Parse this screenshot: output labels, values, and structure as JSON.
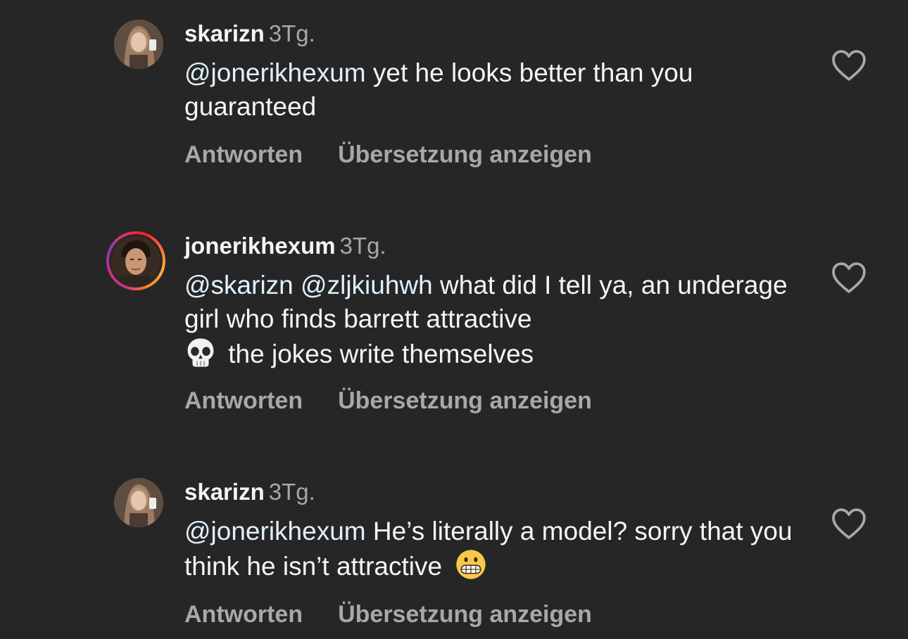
{
  "comments": [
    {
      "username": "skarizn",
      "time": "3Tg.",
      "mention": "@jonerikhexum",
      "text": " yet he looks better than you guaranteed",
      "reply_label": "Antworten",
      "translate_label": "Übersetzung anzeigen",
      "avatar_icon": "avatar-photo",
      "has_story_ring": false
    },
    {
      "username": "jonerikhexum",
      "time": "3Tg.",
      "mention": "@skarizn @zljkiuhwh",
      "text": " what did I tell ya, an underage girl who finds barrett attractive",
      "text_after_emoji": "the jokes write themselves",
      "emoji_icon": "skull-emoji",
      "reply_label": "Antworten",
      "translate_label": "Übersetzung anzeigen",
      "avatar_icon": "avatar-photo",
      "has_story_ring": true
    },
    {
      "username": "skarizn",
      "time": "3Tg.",
      "mention": "@jonerikhexum",
      "text": " He’s literally a model? sorry that you think he isn’t attractive",
      "emoji_icon": "grimacing-face-emoji",
      "reply_label": "Antworten",
      "translate_label": "Übersetzung anzeigen",
      "avatar_icon": "avatar-photo",
      "has_story_ring": false
    }
  ],
  "icons": {
    "like": "heart-outline-icon"
  },
  "colors": {
    "background": "#262626",
    "text": "#f5f5f5",
    "secondary": "#a8a8a8",
    "mention": "#e0f1ff"
  }
}
